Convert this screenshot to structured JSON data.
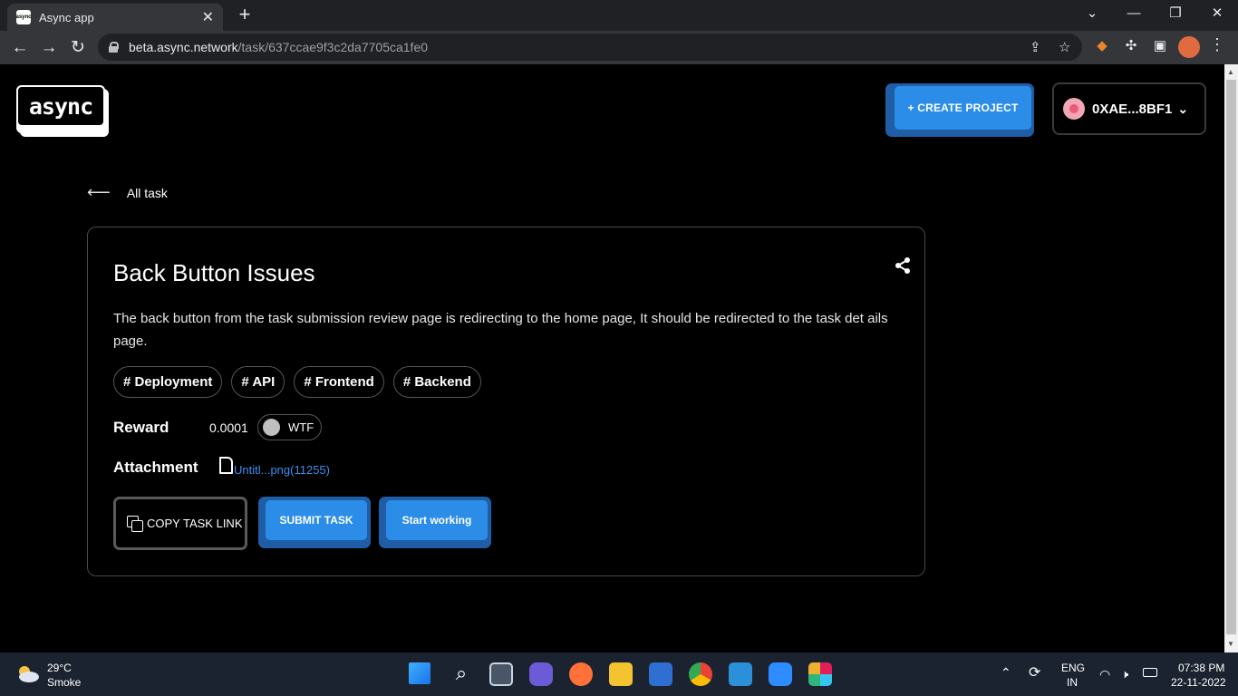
{
  "browser": {
    "tab_title": "Async app",
    "url_host": "beta.async.network",
    "url_path": "/task/637ccae9f3c2da7705ca1fe0"
  },
  "header": {
    "logo_text": "async",
    "create_project_label": "+ CREATE PROJECT",
    "wallet_address": "0XAE...8BF1"
  },
  "nav": {
    "back_label": "All task"
  },
  "task": {
    "title": "Back Button Issues",
    "description": "The back button from the task submission review page is redirecting to the home page, It should be redirected to the task det ails page.",
    "tags": [
      "# Deployment",
      "# API",
      "# Frontend",
      "# Backend"
    ],
    "reward_label": "Reward",
    "reward_amount": "0.0001",
    "reward_token": "WTF",
    "attachment_label": "Attachment",
    "attachment_name": "Untitl...png(11255)",
    "copy_link_label": "COPY TASK LINK",
    "submit_label": "SUBMIT TASK",
    "start_label": "Start working"
  },
  "taskbar": {
    "weather_temp": "29°C",
    "weather_desc": "Smoke",
    "lang_top": "ENG",
    "lang_bottom": "IN",
    "time": "07:38 PM",
    "date": "22-11-2022"
  },
  "colors": {
    "accent_blue": "#2b8de8",
    "accent_blue_shadow": "#1f5ea6",
    "link_blue": "#3d8ef0"
  }
}
